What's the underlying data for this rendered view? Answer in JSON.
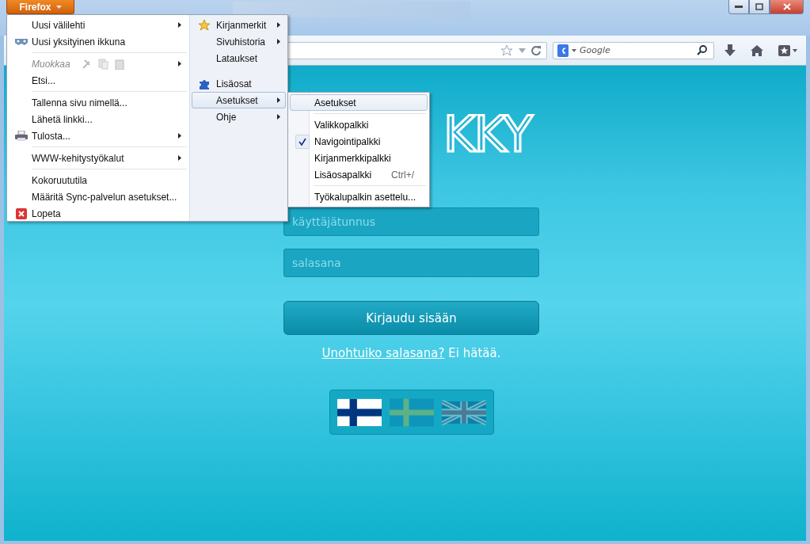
{
  "app_button": {
    "label": "Firefox"
  },
  "toolbar": {
    "search": {
      "placeholder": "Google"
    }
  },
  "page": {
    "logo": "KKY",
    "username": {
      "placeholder": "käyttäjätunnus"
    },
    "password": {
      "placeholder": "salasana"
    },
    "login_button": "Kirjaudu sisään",
    "forgot_link": "Unohtuiko salasana?",
    "forgot_text": "Ei hätää.",
    "languages": [
      {
        "kind": "finnish",
        "selected": true
      },
      {
        "kind": "swedish",
        "selected": false
      },
      {
        "kind": "british",
        "selected": false
      }
    ]
  },
  "menu": {
    "left": [
      {
        "kind": "item",
        "label": "Uusi välilehti",
        "submenu": true,
        "disabled": false
      },
      {
        "kind": "item",
        "label": "Uusi yksityinen ikkuna",
        "submenu": false,
        "disabled": false
      },
      {
        "kind": "separator"
      },
      {
        "kind": "edit",
        "label": "Muokkaa",
        "submenu": true,
        "disabled": true
      },
      {
        "kind": "item",
        "label": "Etsi...",
        "submenu": false,
        "disabled": false
      },
      {
        "kind": "separator"
      },
      {
        "kind": "item",
        "label": "Tallenna sivu nimellä...",
        "submenu": false,
        "disabled": false
      },
      {
        "kind": "item",
        "label": "Lähetä linkki...",
        "submenu": false,
        "disabled": false
      },
      {
        "kind": "item",
        "label": "Tulosta...",
        "submenu": true,
        "disabled": false
      },
      {
        "kind": "separator"
      },
      {
        "kind": "item",
        "label": "WWW-kehitystyökalut",
        "submenu": true,
        "disabled": false
      },
      {
        "kind": "separator"
      },
      {
        "kind": "item",
        "label": "Kokoruututila",
        "submenu": false,
        "disabled": false
      },
      {
        "kind": "item",
        "label": "Määritä Sync-palvelun asetukset...",
        "submenu": false,
        "disabled": false
      },
      {
        "kind": "item",
        "label": "Lopeta",
        "submenu": false,
        "disabled": false
      }
    ],
    "right": [
      {
        "kind": "item",
        "label": "Kirjanmerkit",
        "submenu": true,
        "selected": false
      },
      {
        "kind": "item",
        "label": "Sivuhistoria",
        "submenu": true,
        "selected": false
      },
      {
        "kind": "item",
        "label": "Lataukset",
        "submenu": false,
        "selected": false
      },
      {
        "kind": "gap"
      },
      {
        "kind": "item",
        "label": "Lisäosat",
        "submenu": false,
        "selected": false
      },
      {
        "kind": "item",
        "label": "Asetukset",
        "submenu": true,
        "selected": true
      },
      {
        "kind": "item",
        "label": "Ohje",
        "submenu": true,
        "selected": false
      }
    ]
  },
  "submenu": [
    {
      "kind": "item",
      "label": "Asetukset",
      "selected": true,
      "checked": false
    },
    {
      "kind": "separator"
    },
    {
      "kind": "item",
      "label": "Valikkopalkki",
      "selected": false,
      "checked": false
    },
    {
      "kind": "item",
      "label": "Navigointipalkki",
      "selected": false,
      "checked": true
    },
    {
      "kind": "item",
      "label": "Kirjanmerkkipalkki",
      "selected": false,
      "checked": false
    },
    {
      "kind": "item",
      "label": "Lisäosapalkki",
      "shortcut": "Ctrl+/",
      "selected": false,
      "checked": false
    },
    {
      "kind": "separator"
    },
    {
      "kind": "item",
      "label": "Työkalupalkin asettelu...",
      "selected": false,
      "checked": false
    }
  ]
}
